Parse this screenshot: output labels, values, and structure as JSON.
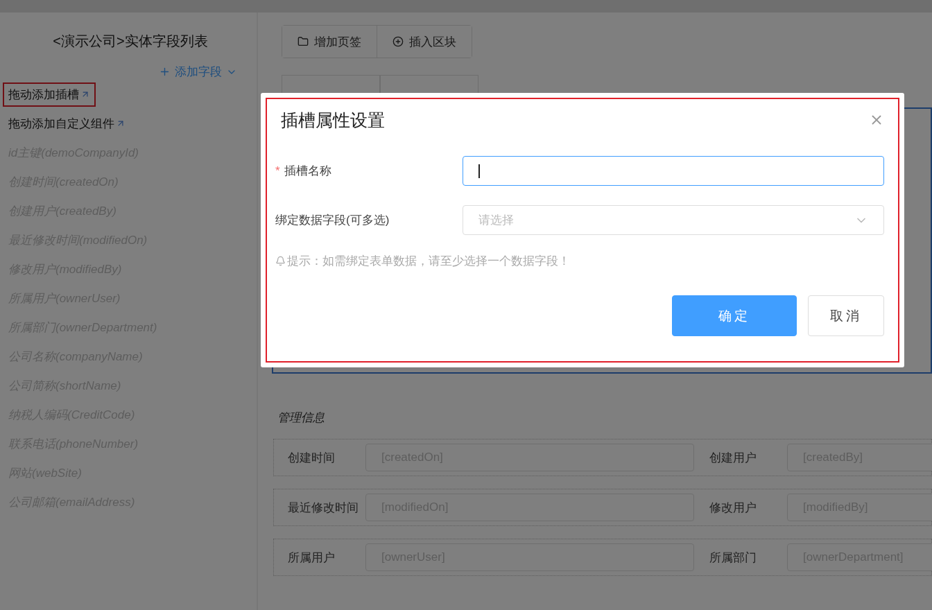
{
  "sidebar": {
    "title": "<演示公司>实体字段列表",
    "add_button": "添加字段",
    "items": [
      {
        "label": "拖动添加插槽",
        "kind": "action",
        "highlighted": true
      },
      {
        "label": "拖动添加自定义组件",
        "kind": "action",
        "highlighted": false
      },
      {
        "label": "id主键(demoCompanyId)",
        "kind": "field",
        "highlighted": false
      },
      {
        "label": "创建时间(createdOn)",
        "kind": "field",
        "highlighted": false
      },
      {
        "label": "创建用户(createdBy)",
        "kind": "field",
        "highlighted": false
      },
      {
        "label": "最近修改时间(modifiedOn)",
        "kind": "field",
        "highlighted": false
      },
      {
        "label": "修改用户(modifiedBy)",
        "kind": "field",
        "highlighted": false
      },
      {
        "label": "所属用户(ownerUser)",
        "kind": "field",
        "highlighted": false
      },
      {
        "label": "所属部门(ownerDepartment)",
        "kind": "field",
        "highlighted": false
      },
      {
        "label": "公司名称(companyName)",
        "kind": "field",
        "highlighted": false
      },
      {
        "label": "公司简称(shortName)",
        "kind": "field",
        "highlighted": false
      },
      {
        "label": "纳税人编码(CreditCode)",
        "kind": "field",
        "highlighted": false
      },
      {
        "label": "联系电话(phoneNumber)",
        "kind": "field",
        "highlighted": false
      },
      {
        "label": "网站(webSite)",
        "kind": "field",
        "highlighted": false
      },
      {
        "label": "公司邮箱(emailAddress)",
        "kind": "field",
        "highlighted": false
      }
    ]
  },
  "toolbar": {
    "buttons": [
      {
        "label": "增加页签",
        "kind": "folder"
      },
      {
        "label": "插入区块",
        "kind": "plus"
      }
    ]
  },
  "section": {
    "title": "管理信息",
    "rows": [
      [
        {
          "label": "创建时间",
          "placeholder": "[createdOn]"
        },
        {
          "label": "创建用户",
          "placeholder": "[createdBy]"
        }
      ],
      [
        {
          "label": "最近修改时间",
          "placeholder": "[modifiedOn]"
        },
        {
          "label": "修改用户",
          "placeholder": "[modifiedBy]"
        }
      ],
      [
        {
          "label": "所属用户",
          "placeholder": "[ownerUser]"
        },
        {
          "label": "所属部门",
          "placeholder": "[ownerDepartment]"
        }
      ]
    ]
  },
  "dialog": {
    "title": "插槽属性设置",
    "highlighted": true,
    "fields": [
      {
        "label": "插槽名称",
        "kind": "text",
        "required": true,
        "required_mark": "*",
        "focused": true
      },
      {
        "label": "绑定数据字段(可多选)",
        "kind": "select",
        "required": false,
        "focused": false,
        "placeholder": "请选择"
      }
    ],
    "hint": "提示：如需绑定表单数据，请至少选择一个数据字段！",
    "buttons": [
      {
        "label": "确定",
        "primary": true
      },
      {
        "label": "取消",
        "primary": false
      }
    ]
  }
}
